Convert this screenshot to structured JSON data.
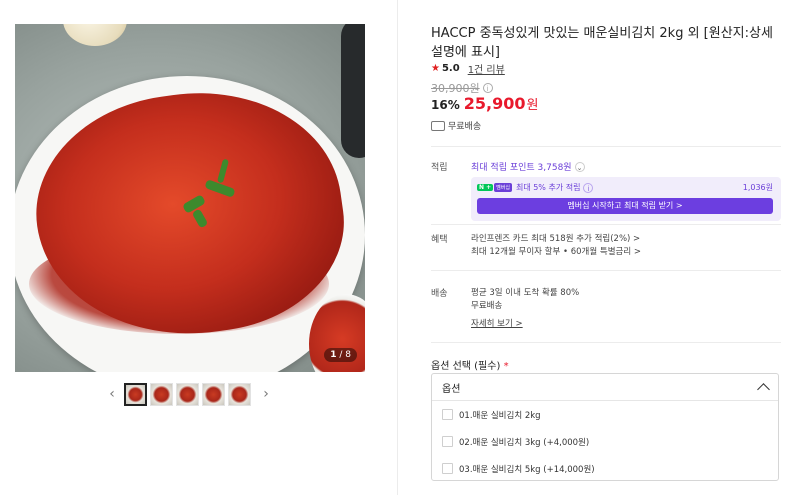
{
  "product": {
    "title": "HACCP 중독성있게 맛있는 매운실비김치 2kg 외 [원산지:상세설명에 표시]",
    "rating_score": "5.0",
    "review_count": "1건 리뷰",
    "original_price": "30,900원",
    "discount_pct": "16%",
    "sale_price": "25,900",
    "price_unit": "원",
    "shipping": "무료배송"
  },
  "gallery": {
    "current": "1",
    "total": "8",
    "thumb_count": 5
  },
  "points": {
    "label": "적립",
    "max_points": "최대 적립 포인트 3,758원",
    "member_text": "최대 5% 추가 적립",
    "member_amount": "1,036원",
    "member_button": "멤버십 시작하고 최대 적립 받기 >",
    "badge_npay": "N +",
    "badge_membership": "멤버십"
  },
  "benefit": {
    "label": "혜택",
    "lines": [
      "라인프렌즈 카드 최대 518원 추가 적립(2%) >",
      "최대 12개월 무이자 할부 • 60개월 특별금리 >"
    ]
  },
  "delivery": {
    "label": "배송",
    "lines": [
      "평균 3일 이내 도착 확률 80%",
      "무료배송"
    ],
    "detail_link": "자세히 보기 >"
  },
  "options": {
    "label": "옵션 선택 (필수)",
    "required_mark": "*",
    "select_placeholder": "옵션",
    "items": [
      "01.매운 실비김치 2kg",
      "02.매운 실비김치 3kg (+4,000원)",
      "03.매운 실비김치 5kg (+14,000원)"
    ]
  },
  "colors": {
    "sale": "#e8192c",
    "membership": "#6c3ee0",
    "npay": "#03c75a"
  }
}
